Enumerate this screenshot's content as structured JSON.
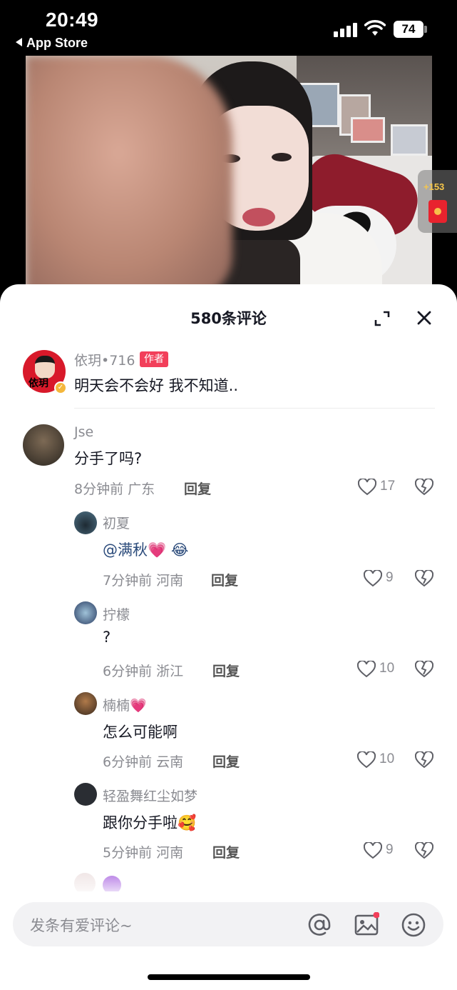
{
  "status_bar": {
    "time": "20:49",
    "back_label": "App Store",
    "battery": "74"
  },
  "video": {
    "side_badge_count": "+153"
  },
  "comments_sheet": {
    "title": "580条评论",
    "author_comment": {
      "name": "依玥•716",
      "tag": "作者",
      "text": "明天会不会好 我不知道.."
    },
    "comments": [
      {
        "name": "Jse",
        "text": "分手了吗?",
        "time_location": "8分钟前 广东",
        "reply_label": "回复",
        "likes": "17"
      }
    ],
    "replies": [
      {
        "name": "初夏",
        "text": "@满秋💗 😂",
        "time_location": "7分钟前 河南",
        "reply_label": "回复",
        "likes": "9"
      },
      {
        "name": "拧檬",
        "text": "?",
        "time_location": "6分钟前 浙江",
        "reply_label": "回复",
        "likes": "10"
      },
      {
        "name": "楠楠💗",
        "text": "怎么可能啊",
        "time_location": "6分钟前 云南",
        "reply_label": "回复",
        "likes": "10"
      },
      {
        "name": "轻盈舞红尘如梦",
        "text": "跟你分手啦🥰",
        "time_location": "5分钟前 河南",
        "reply_label": "回复",
        "likes": "9"
      }
    ]
  },
  "input": {
    "placeholder": "发条有爱评论~"
  },
  "colors": {
    "author_tag": "#f23f5a",
    "text_primary": "#161823",
    "text_secondary": "#8a8b91"
  }
}
